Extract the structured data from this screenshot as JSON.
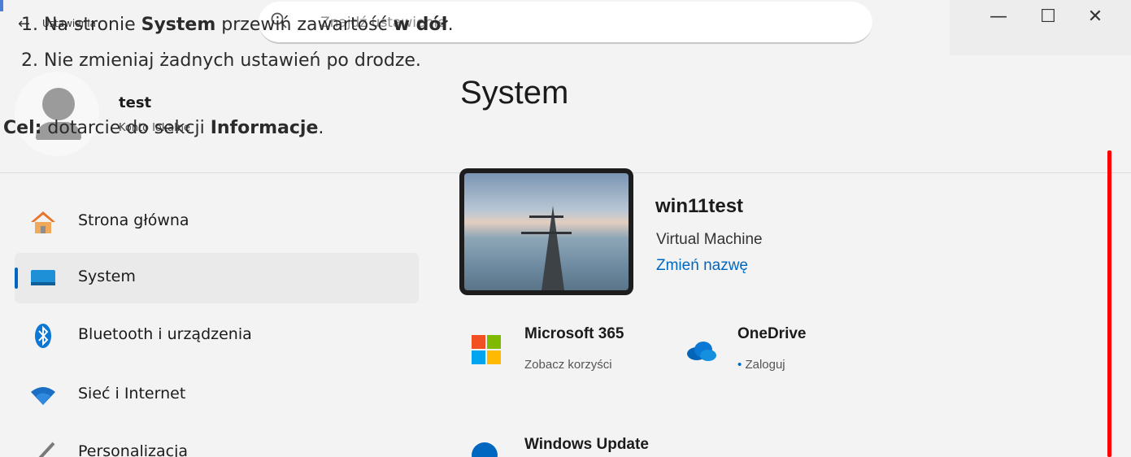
{
  "titlebar": {
    "app_title": "Ustawienia",
    "back_glyph": "←",
    "search_placeholder": "Znajdź ustawienie",
    "minimize": "—",
    "maximize": "☐",
    "close": "✕"
  },
  "overlay": {
    "line1": {
      "num": "1.",
      "pre": "Na stronie ",
      "b1": "System",
      "mid": " przewiń zawartość ",
      "b2": "w dół",
      "post": "."
    },
    "line2": {
      "num": "2.",
      "text": "Nie zmieniaj żadnych ustawień po drodze."
    },
    "goal": {
      "b": "Cel:",
      "pre": " dotarcie do sekcji ",
      "b2": "Informacje",
      "post": "."
    }
  },
  "user": {
    "name": "test",
    "account": "Konto lokalne"
  },
  "sidebar": {
    "items": [
      {
        "label": "Strona główna",
        "icon": "home-icon"
      },
      {
        "label": "System",
        "icon": "monitor-icon",
        "active": true
      },
      {
        "label": "Bluetooth i urządzenia",
        "icon": "bluetooth-icon"
      },
      {
        "label": "Sieć i Internet",
        "icon": "wifi-icon"
      },
      {
        "label": "Personalizacja",
        "icon": "brush-icon"
      }
    ]
  },
  "main": {
    "title": "System",
    "device": {
      "name": "win11test",
      "model": "Virtual Machine",
      "rename": "Zmień nazwę"
    },
    "cards": {
      "ms365": {
        "title": "Microsoft 365",
        "sub": "Zobacz korzyści"
      },
      "onedrive": {
        "title": "OneDrive",
        "dot": "•",
        "sub": "Zaloguj"
      },
      "update": {
        "title": "Windows Update"
      }
    }
  },
  "colors": {
    "accent": "#0067c0",
    "scroll_marker": "#ff0000"
  }
}
